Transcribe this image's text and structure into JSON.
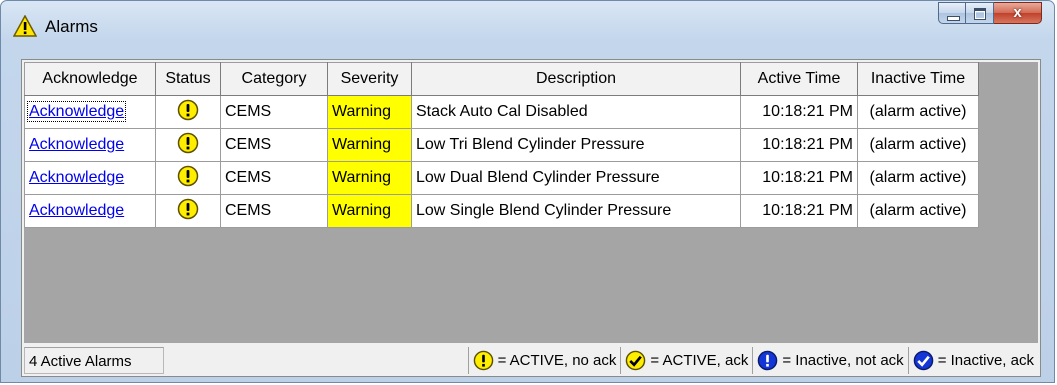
{
  "window": {
    "title": "Alarms",
    "minimize_glyph": "",
    "maximize_glyph": "",
    "close_glyph": "x"
  },
  "table": {
    "columns": [
      "Acknowledge",
      "Status",
      "Category",
      "Severity",
      "Description",
      "Active Time",
      "Inactive Time"
    ],
    "rows": [
      {
        "ack": "Acknowledge",
        "status_icon": "active-no-ack-icon",
        "category": "CEMS",
        "severity": "Warning",
        "description": "Stack Auto Cal Disabled",
        "active_time": "10:18:21 PM",
        "inactive_time": "(alarm active)"
      },
      {
        "ack": "Acknowledge",
        "status_icon": "active-no-ack-icon",
        "category": "CEMS",
        "severity": "Warning",
        "description": "Low Tri Blend Cylinder Pressure",
        "active_time": "10:18:21 PM",
        "inactive_time": "(alarm active)"
      },
      {
        "ack": "Acknowledge",
        "status_icon": "active-no-ack-icon",
        "category": "CEMS",
        "severity": "Warning",
        "description": "Low Dual Blend Cylinder Pressure",
        "active_time": "10:18:21 PM",
        "inactive_time": "(alarm active)"
      },
      {
        "ack": "Acknowledge",
        "status_icon": "active-no-ack-icon",
        "category": "CEMS",
        "severity": "Warning",
        "description": "Low Single Blend Cylinder Pressure",
        "active_time": "10:18:21 PM",
        "inactive_time": "(alarm active)"
      }
    ]
  },
  "statusbar": {
    "count": "4 Active Alarms",
    "legend": [
      {
        "icon": "active-no-ack-icon",
        "label": "= ACTIVE, no ack"
      },
      {
        "icon": "active-ack-icon",
        "label": "= ACTIVE, ack"
      },
      {
        "icon": "inactive-not-ack-icon",
        "label": "= Inactive, not ack"
      },
      {
        "icon": "inactive-ack-icon",
        "label": "= Inactive, ack"
      }
    ]
  },
  "colors": {
    "severity_warning": "#ffff00",
    "link": "#0000ee",
    "active_icon": "#ffee00",
    "inactive_icon": "#1436d6",
    "grid_background": "#a5a5a5"
  }
}
